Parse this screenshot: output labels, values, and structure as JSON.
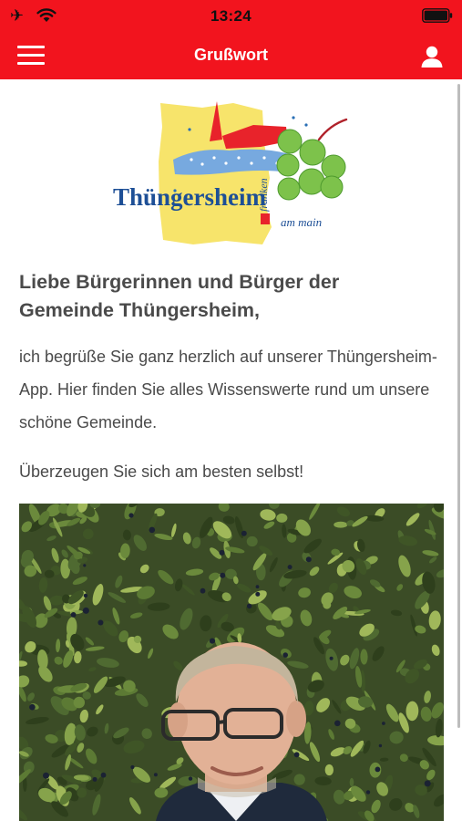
{
  "status_bar": {
    "time": "13:24",
    "airplane_icon": "airplane-icon",
    "wifi_icon": "wifi-icon",
    "battery_icon": "battery-icon"
  },
  "nav": {
    "title": "Grußwort",
    "menu_icon": "hamburger-menu-icon",
    "user_icon": "user-icon"
  },
  "colors": {
    "brand_red": "#f2141e",
    "text": "#4a4a4a",
    "logo_yellow": "#f7e46b",
    "logo_blue": "#1d4f96",
    "logo_green": "#7dc24b"
  },
  "logo": {
    "name": "Thüngersheim",
    "tag_franken": "franken",
    "tag_ammain": "am main"
  },
  "content": {
    "heading": "Liebe Bürgerinnen und Bürger der Gemeinde Thüngersheim,",
    "paragraph1": "ich begrüße Sie ganz herzlich auf unserer Thüngersheim-App. Hier finden Sie alles Wissenswerte rund um unsere schöne Gemeinde.",
    "paragraph2": "Überzeugen Sie sich am besten selbst!"
  }
}
